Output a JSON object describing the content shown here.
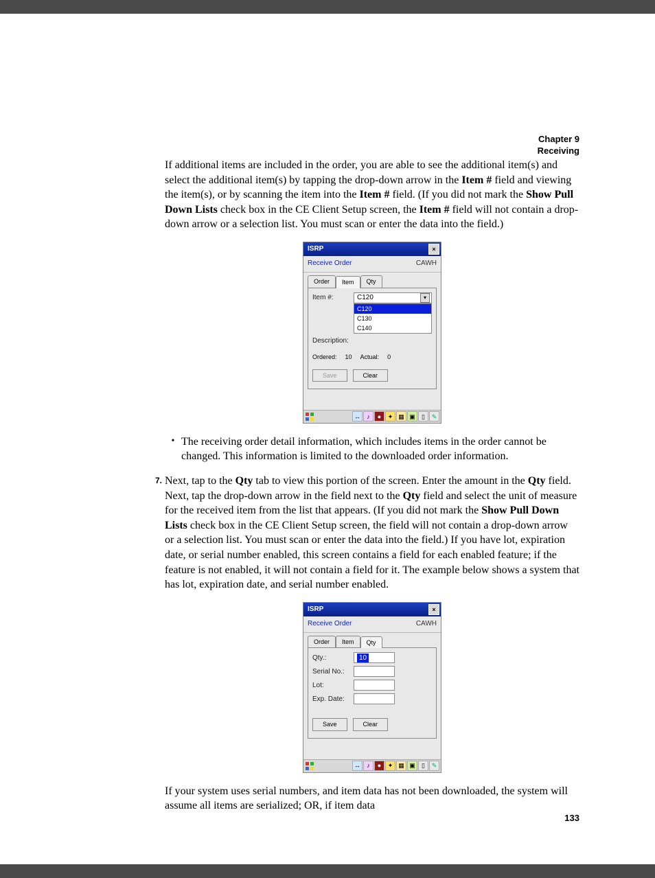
{
  "header": {
    "chapter": "Chapter 9",
    "title": "Receiving"
  },
  "body": {
    "p1": {
      "t1": "If additional items are included in the order, you are able to see the additional item(s) and select the additional item(s) by tapping the drop-down arrow in the ",
      "b1": "Item #",
      "t2": " field and viewing the item(s), or by scanning the item into the ",
      "b2": "Item #",
      "t3": " field. (If you did not mark the ",
      "b3": "Show Pull Down Lists",
      "t4": " check box in the CE Client Setup screen, the ",
      "b4": "Item #",
      "t5": " field will not contain a drop-down arrow or a selection list. You must scan or enter the data into the field.)"
    },
    "bullet1": "The receiving order detail information, which includes items in the order cannot be changed. This information is limited to the downloaded order information.",
    "step7": {
      "num": "7.",
      "t1": "Next, tap to the ",
      "b1": "Qty",
      "t2": " tab to view this portion of the screen. Enter the amount in the ",
      "b2": "Qty",
      "t3": " field. Next, tap the drop-down arrow in the field next to the ",
      "b3": "Qty",
      "t4": " field and select the unit of measure for the received item from the list that appears. (If you did not mark the ",
      "b4": "Show Pull Down Lists",
      "t5": " check box in the CE Client Setup screen, the field will not contain a drop-down arrow or a selection list. You must scan or enter the data into the field.) If you have lot, expiration date, or serial number enabled, this screen contains a field for each enabled feature; if the feature is not enabled, it will not contain a field for it. The example below shows a system that has lot, expiration date, and serial number enabled."
    },
    "p2": "If your system uses serial numbers, and item data has not been downloaded, the system will assume all items are serialized; OR, if item data"
  },
  "fig1": {
    "window_title": "ISRP",
    "screen_name": "Receive Order",
    "wh_code": "CAWH",
    "tabs": [
      "Order",
      "Item",
      "Qty"
    ],
    "item_label": "Item #:",
    "item_value": "C120",
    "dropdown": [
      "C120",
      "C130",
      "C140"
    ],
    "desc_label": "Description:",
    "ordered_label": "Ordered:",
    "ordered_value": "10",
    "actual_label": "Actual:",
    "actual_value": "0",
    "save": "Save",
    "clear": "Clear"
  },
  "fig2": {
    "window_title": "ISRP",
    "screen_name": "Receive Order",
    "wh_code": "CAWH",
    "tabs": [
      "Order",
      "Item",
      "Qty"
    ],
    "qty_label": "Qty.:",
    "qty_value": "10",
    "serial_label": "Serial No.:",
    "lot_label": "Lot:",
    "exp_label": "Exp. Date:",
    "save": "Save",
    "clear": "Clear"
  },
  "footer": {
    "page": "133"
  }
}
